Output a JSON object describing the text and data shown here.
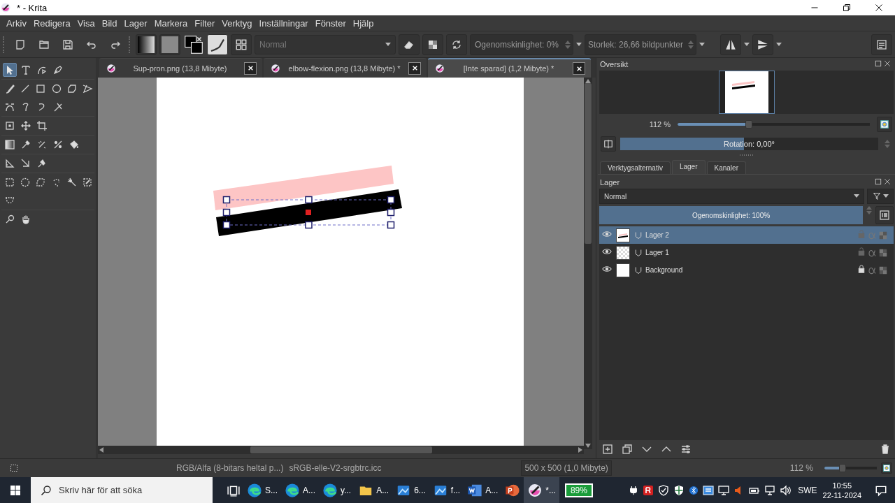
{
  "window": {
    "title": "* - Krita"
  },
  "menu": [
    "Arkiv",
    "Redigera",
    "Visa",
    "Bild",
    "Lager",
    "Markera",
    "Filter",
    "Verktyg",
    "Inställningar",
    "Fönster",
    "Hjälp"
  ],
  "toolbar": {
    "blend_mode": "Normal",
    "opacity": "Ogenomskinlighet: 0%",
    "size": "Storlek: 26,66 bildpunkter"
  },
  "toolbox": {
    "rows": [
      {
        "tools": [
          {
            "selected": true
          },
          {
            "selected": false
          },
          {
            "selected": false
          },
          {
            "selected": false
          }
        ]
      },
      {
        "tools": [
          {
            "selected": false
          },
          {
            "selected": false
          },
          {
            "selected": false
          },
          {
            "selected": false
          },
          {
            "selected": false
          },
          {
            "selected": false
          }
        ]
      },
      {
        "tools": [
          {
            "selected": false
          },
          {
            "selected": false
          },
          {
            "selected": false
          },
          {
            "selected": false
          }
        ]
      },
      {
        "tools": [
          {
            "selected": false
          },
          {
            "selected": false
          },
          {
            "selected": false
          }
        ]
      },
      {
        "tools": [
          {
            "selected": false
          },
          {
            "selected": false
          },
          {
            "selected": false
          },
          {
            "selected": false
          },
          {
            "selected": false
          }
        ]
      },
      {
        "tools": [
          {
            "selected": false
          },
          {
            "selected": false
          },
          {
            "selected": false
          }
        ]
      },
      {
        "tools": [
          {
            "selected": false
          },
          {
            "selected": false
          },
          {
            "selected": false
          },
          {
            "selected": false
          },
          {
            "selected": false
          },
          {
            "selected": false
          }
        ]
      },
      {
        "tools": [
          {
            "selected": false
          }
        ]
      },
      {
        "tools": [
          {
            "selected": false
          },
          {
            "selected": false
          }
        ]
      }
    ]
  },
  "documents": [
    {
      "title": "Sup-pron.png (13,8 Mibyte)",
      "selected": false
    },
    {
      "title": "elbow-flexion.png (13,8 Mibyte) *",
      "selected": false
    },
    {
      "title": "[Inte sparad]  (1,2 Mibyte) *",
      "selected": true
    }
  ],
  "overview": {
    "title": "Översikt",
    "zoom": "112 %",
    "zoom_slider": {
      "level": 0.37
    },
    "rotation": {
      "label": "Rotation: 0,00°",
      "level": 0.48
    }
  },
  "docker_tabs": [
    {
      "label": "Verktygsalternativ",
      "selected": false
    },
    {
      "label": "Lager",
      "selected": true
    },
    {
      "label": "Kanaler",
      "selected": false
    }
  ],
  "layers_panel": {
    "title": "Lager",
    "blend_mode": "Normal",
    "opacity": {
      "label": "Ogenomskinlighet:  100%",
      "level": 1
    },
    "layers": [
      {
        "name": "Lager 2",
        "selected": true,
        "visible": true,
        "locked": false,
        "kind": "strokes"
      },
      {
        "name": "Lager 1",
        "selected": false,
        "visible": true,
        "locked": false,
        "kind": "transparent"
      },
      {
        "name": "Background",
        "selected": false,
        "visible": true,
        "locked": true,
        "kind": "white"
      }
    ]
  },
  "status_bar": {
    "color_space": "RGB/Alfa (8-bitars heltal p...)",
    "profile": "sRGB-elle-V2-srgbtrc.icc",
    "image_size": "500 x 500 (1,0 Mibyte)",
    "zoom": "112 %",
    "zoom_slider": {
      "level": 0.35
    }
  },
  "taskbar": {
    "search": {
      "placeholder": "Skriv här för att söka"
    },
    "apps": [
      {
        "label": "S...",
        "kind": "edge",
        "active": false
      },
      {
        "label": "A...",
        "kind": "edge",
        "active": false
      },
      {
        "label": "y...",
        "kind": "edge",
        "active": false
      },
      {
        "label": "A...",
        "kind": "folder",
        "active": false
      },
      {
        "label": "6...",
        "kind": "photos",
        "active": false
      },
      {
        "label": "f...",
        "kind": "photos",
        "active": false
      },
      {
        "label": "A...",
        "kind": "word",
        "active": false
      },
      {
        "kind": "powerpoint",
        "active": false
      },
      {
        "label": "*...",
        "kind": "krita",
        "active": true
      }
    ],
    "battery": "89%",
    "language": "SWE",
    "time": "10:55",
    "date": "22-11-2024"
  }
}
